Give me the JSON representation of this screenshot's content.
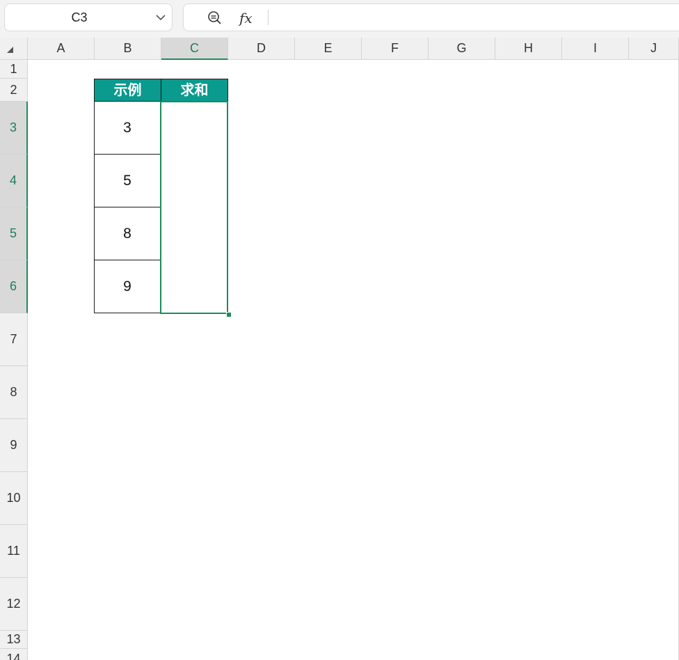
{
  "name_box": {
    "value": "C3"
  },
  "formula_bar": {
    "fx_label": "fx",
    "value": ""
  },
  "columns": [
    "A",
    "B",
    "C",
    "D",
    "E",
    "F",
    "G",
    "H",
    "I",
    "J"
  ],
  "selected_column": "C",
  "rows": [
    "1",
    "2",
    "3",
    "4",
    "5",
    "6",
    "7",
    "8",
    "9",
    "10",
    "11",
    "12",
    "13",
    "14"
  ],
  "selected_rows": [
    "3",
    "4",
    "5",
    "6"
  ],
  "table": {
    "headers": [
      "示例",
      "求和"
    ],
    "values": [
      "3",
      "5",
      "8",
      "9"
    ],
    "header_color": "#0a9a8e"
  },
  "accent_color": "#1e8b5c"
}
